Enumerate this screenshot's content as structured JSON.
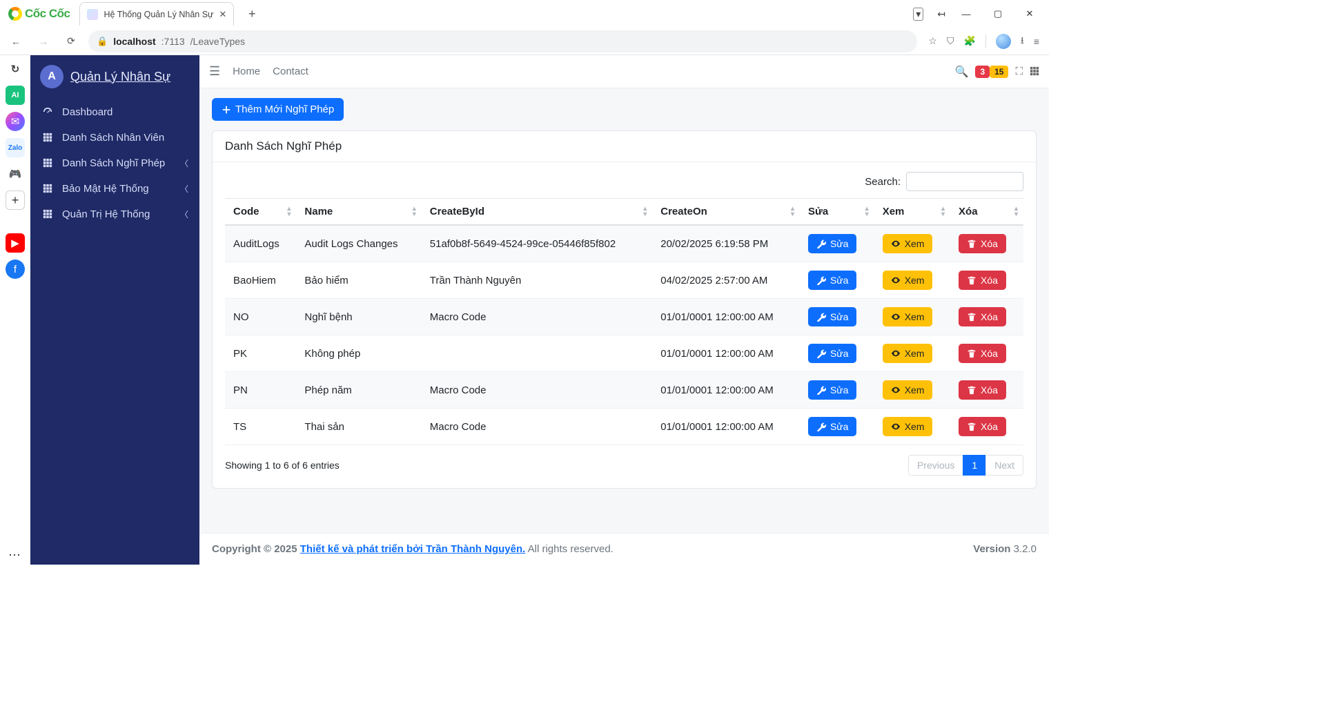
{
  "browser": {
    "logo_text": "Cốc Cốc",
    "tab_title": "Hệ Thống Quản Lý Nhân Sự",
    "url_host": "localhost",
    "url_port": ":7113",
    "url_path": "/LeaveTypes"
  },
  "app": {
    "brand": "Quản Lý Nhân Sự",
    "brand_initial": "A",
    "nav": [
      {
        "icon": "dashboard-icon",
        "label": "Dashboard",
        "expandable": false
      },
      {
        "icon": "grid-icon",
        "label": "Danh Sách Nhân Viên",
        "expandable": false
      },
      {
        "icon": "grid-icon",
        "label": "Danh Sách Nghĩ Phép",
        "expandable": true
      },
      {
        "icon": "grid-icon",
        "label": "Bảo Mật Hệ Thống",
        "expandable": true
      },
      {
        "icon": "grid-icon",
        "label": "Quản Trị Hệ Thống",
        "expandable": true
      }
    ]
  },
  "topbar": {
    "links": [
      "Home",
      "Contact"
    ],
    "badge_red": "3",
    "badge_yellow": "15"
  },
  "page": {
    "add_button": "Thêm Mới Nghĩ Phép",
    "card_title": "Danh Sách Nghĩ Phép",
    "search_label": "Search:",
    "search_value": "",
    "columns": [
      "Code",
      "Name",
      "CreateById",
      "CreateOn",
      "Sửa",
      "Xem",
      "Xóa"
    ],
    "actions": {
      "edit": "Sửa",
      "view": "Xem",
      "delete": "Xóa"
    },
    "rows": [
      {
        "code": "AuditLogs",
        "name": "Audit Logs Changes",
        "createById": "51af0b8f-5649-4524-99ce-05446f85f802",
        "createOn": "20/02/2025 6:19:58 PM"
      },
      {
        "code": "BaoHiem",
        "name": "Bảo hiểm",
        "createById": "Trần Thành Nguyên",
        "createOn": "04/02/2025 2:57:00 AM"
      },
      {
        "code": "NO",
        "name": "Nghĩ bệnh",
        "createById": "Macro Code",
        "createOn": "01/01/0001 12:00:00 AM"
      },
      {
        "code": "PK",
        "name": "Không phép",
        "createById": "",
        "createOn": "01/01/0001 12:00:00 AM"
      },
      {
        "code": "PN",
        "name": "Phép năm",
        "createById": "Macro Code",
        "createOn": "01/01/0001 12:00:00 AM"
      },
      {
        "code": "TS",
        "name": "Thai sản",
        "createById": "Macro Code",
        "createOn": "01/01/0001 12:00:00 AM"
      }
    ],
    "info": "Showing 1 to 6 of 6 entries",
    "pagination": {
      "prev": "Previous",
      "current": "1",
      "next": "Next"
    }
  },
  "footer": {
    "copyright_prefix": "Copyright © 2025 ",
    "link": "Thiết kế và phát triển bởi Trần Thành Nguyên.",
    "suffix": " All rights reserved.",
    "version_label": "Version",
    "version": " 3.2.0"
  }
}
